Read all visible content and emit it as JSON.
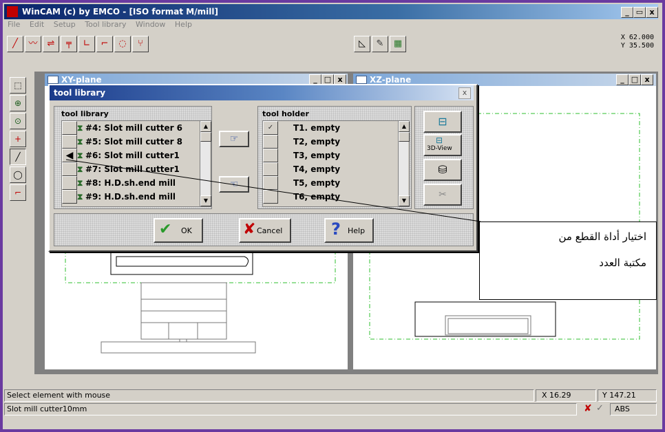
{
  "window": {
    "title": "WinCAM (c) by EMCO - [ISO format M/mill]",
    "minimize": "_",
    "restore": "ı",
    "close": "x"
  },
  "menu": [
    "File",
    "Edit",
    "Setup",
    "Tool library",
    "Window",
    "Help"
  ],
  "toolbar": {
    "coord_x": "X 62.000",
    "coord_y": "Y 35.500"
  },
  "child_windows": {
    "xy_title": "XY-plane",
    "xz_title": "XZ-plane"
  },
  "dialog": {
    "title": "tool library",
    "close": "x",
    "tool_library_label": "tool library",
    "tool_holder_label": "tool holder",
    "tools": [
      {
        "label": "#4: Slot mill cutter 6",
        "checked": false
      },
      {
        "label": "#5: Slot mill cutter 8",
        "checked": false
      },
      {
        "label": "#6: Slot mill cutter1",
        "checked": true
      },
      {
        "label": "#7: Slot mill cutter1",
        "checked": false
      },
      {
        "label": "#8: H.D.sh.end mill",
        "checked": false
      },
      {
        "label": "#9: H.D.sh.end mill",
        "checked": false
      }
    ],
    "holders": [
      {
        "label": "T1. empty",
        "checked": true
      },
      {
        "label": "T2, empty",
        "checked": false
      },
      {
        "label": "T3, empty",
        "checked": false
      },
      {
        "label": "T4, empty",
        "checked": false
      },
      {
        "label": "T5, empty",
        "checked": false
      },
      {
        "label": "T6, empty",
        "checked": false
      }
    ],
    "view_3d_label": "3D-View",
    "ok_label": "OK",
    "cancel_label": "Cancel",
    "help_label": "Help"
  },
  "callout": {
    "line1": "اختيار أداة القطع من",
    "line2": "مكتبة العدد"
  },
  "status": {
    "message": "Select element with mouse",
    "x": "X 16.29",
    "y": "Y 147.21",
    "tool": "Slot mill cutter10mm",
    "abs": "ABS"
  },
  "colors": {
    "frame": "#6a3aa0",
    "title_bar": "#0a246a",
    "axis_lines": "#2cbf2c",
    "accent_red": "#c00000"
  }
}
